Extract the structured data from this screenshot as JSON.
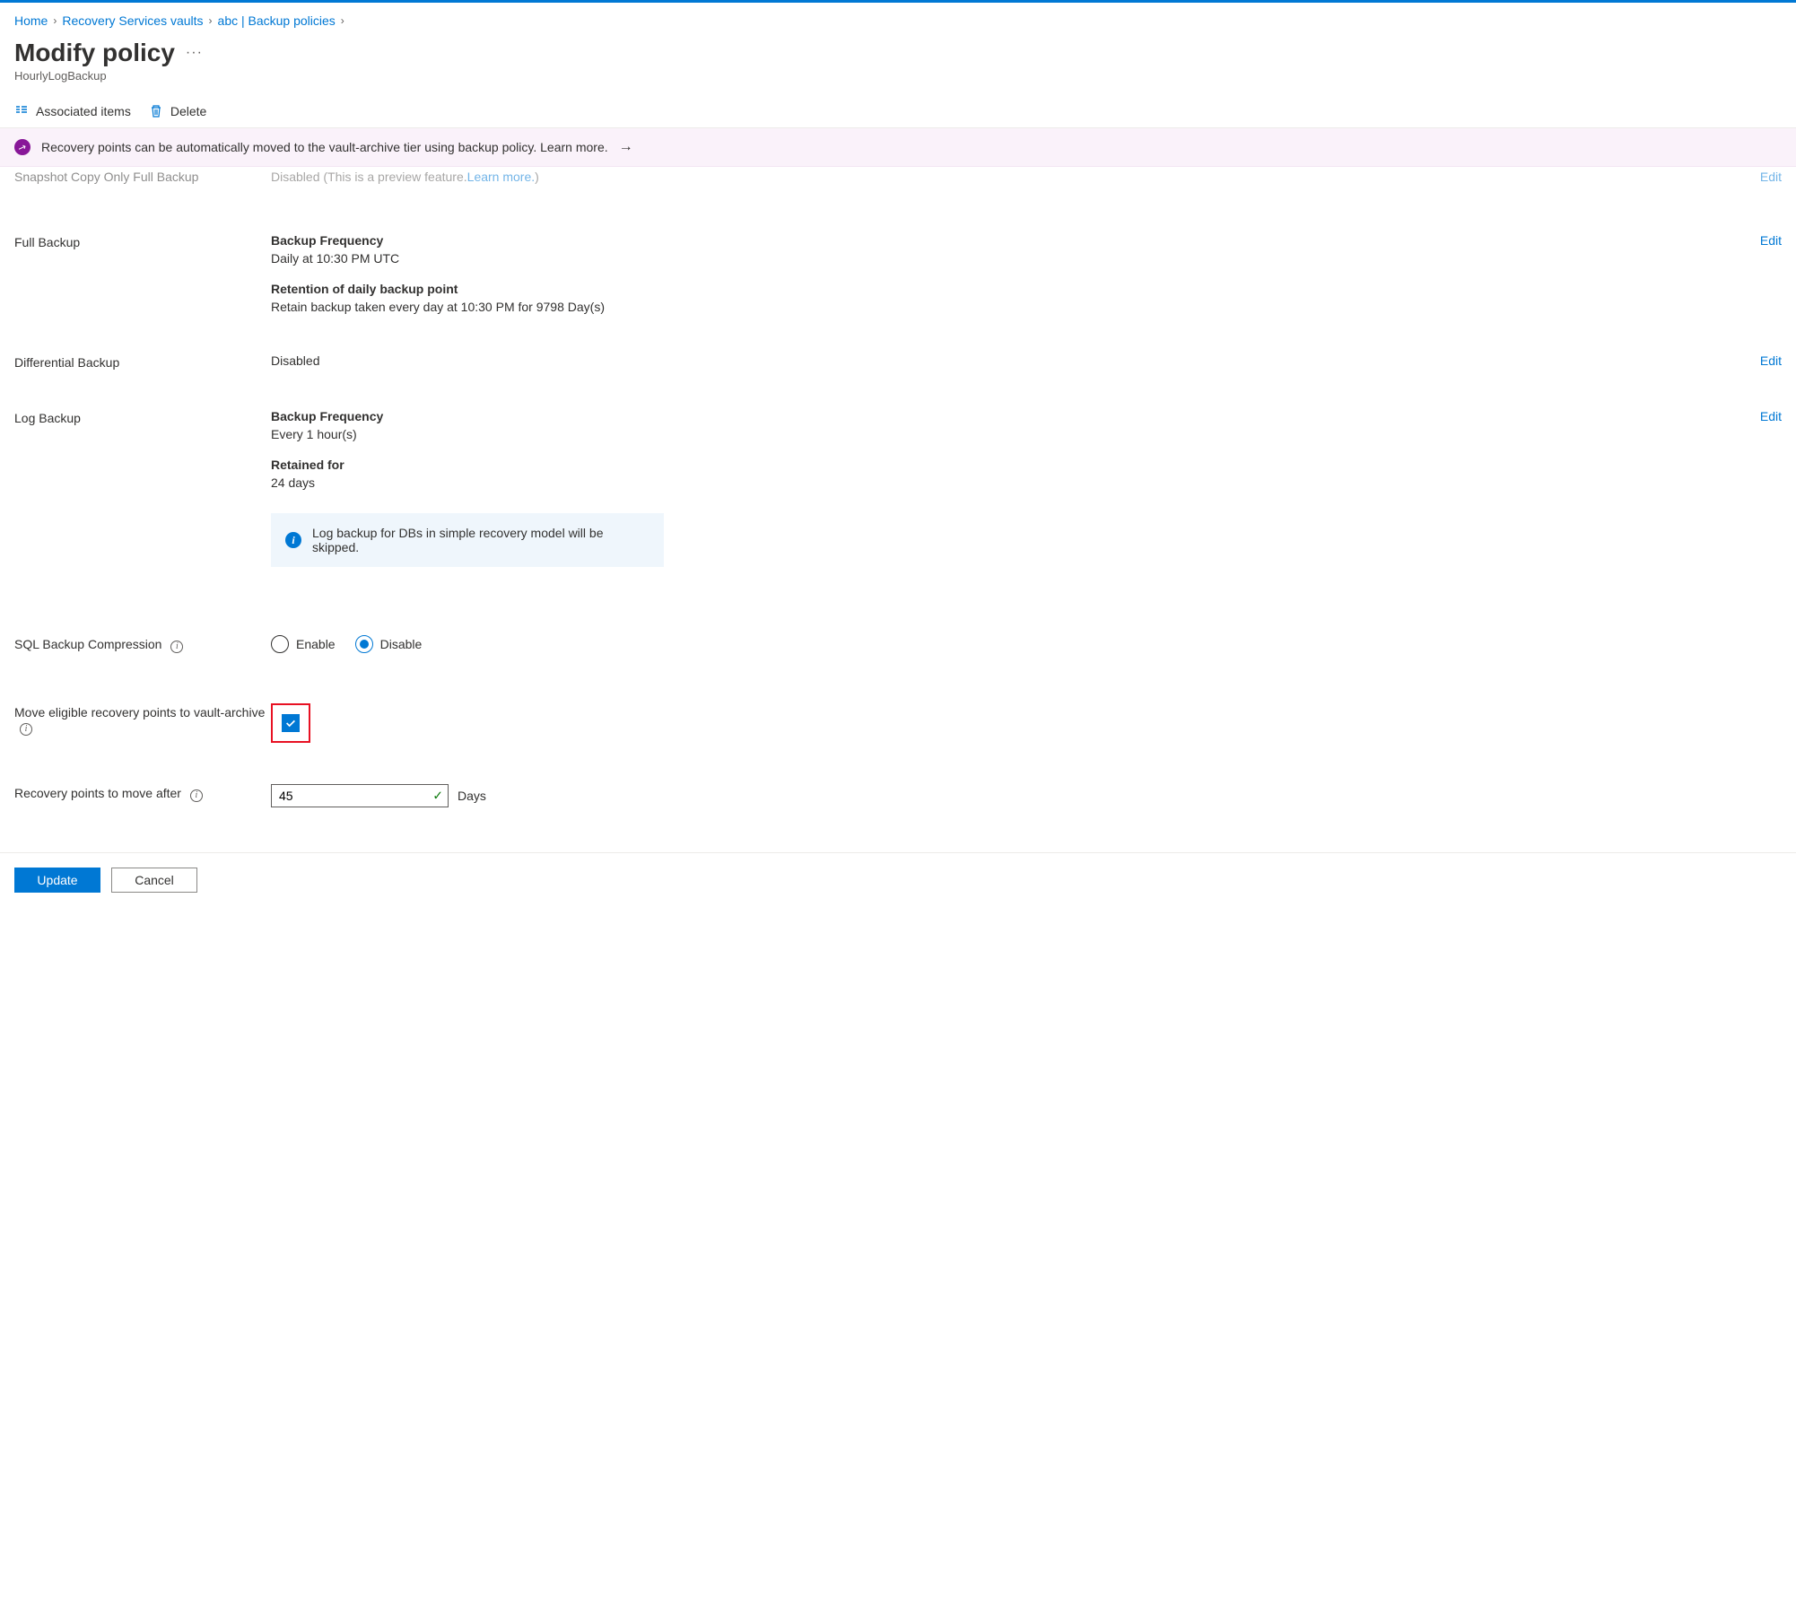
{
  "breadcrumb": {
    "home": "Home",
    "vaults": "Recovery Services vaults",
    "policies": "abc | Backup policies"
  },
  "page": {
    "title": "Modify policy",
    "subtitle": "HourlyLogBackup"
  },
  "commands": {
    "associated": "Associated items",
    "delete": "Delete"
  },
  "banner": {
    "text": "Recovery points can be automatically moved to the vault-archive tier using backup policy. Learn more."
  },
  "partial": {
    "label": "Snapshot Copy Only Full Backup",
    "value": "Disabled (This is a preview feature. ",
    "link": "Learn more.",
    "tail": ")",
    "edit": "Edit"
  },
  "fullBackup": {
    "label": "Full Backup",
    "freqTitle": "Backup Frequency",
    "freqValue": "Daily at 10:30 PM UTC",
    "retTitle": "Retention of daily backup point",
    "retValue": "Retain backup taken every day at 10:30 PM for 9798 Day(s)",
    "edit": "Edit"
  },
  "diffBackup": {
    "label": "Differential Backup",
    "value": "Disabled",
    "edit": "Edit"
  },
  "logBackup": {
    "label": "Log Backup",
    "freqTitle": "Backup Frequency",
    "freqValue": "Every 1 hour(s)",
    "retTitle": "Retained for",
    "retValue": "24 days",
    "note": "Log backup for DBs in simple recovery model will be skipped.",
    "edit": "Edit"
  },
  "compression": {
    "label": "SQL Backup Compression",
    "enable": "Enable",
    "disable": "Disable",
    "selected": "disable"
  },
  "archive": {
    "label": "Move eligible recovery points to vault-archive",
    "checked": true
  },
  "moveAfter": {
    "label": "Recovery points to move after",
    "value": "45",
    "unit": "Days"
  },
  "footer": {
    "update": "Update",
    "cancel": "Cancel"
  }
}
